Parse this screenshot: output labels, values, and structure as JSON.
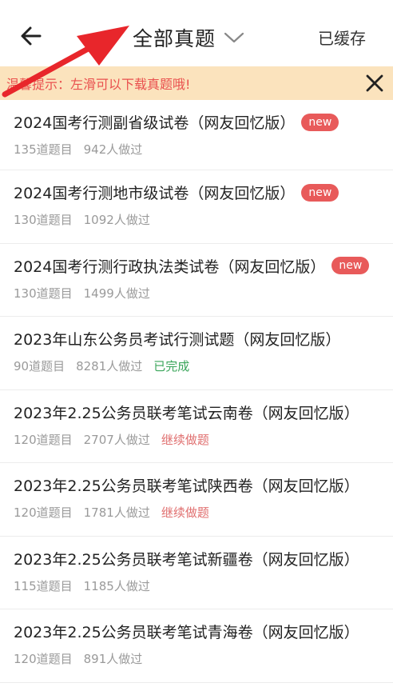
{
  "header": {
    "title": "全部真题",
    "cache_label": "已缓存"
  },
  "tip": {
    "text": "温馨提示：左滑可以下载真题哦!"
  },
  "items": [
    {
      "title": "2024国考行测副省级试卷（网友回忆版）",
      "badge": "new",
      "count": "135道题目",
      "people": "942人做过",
      "status": ""
    },
    {
      "title": "2024国考行测地市级试卷（网友回忆版）",
      "badge": "new",
      "count": "130道题目",
      "people": "1092人做过",
      "status": ""
    },
    {
      "title": "2024国考行测行政执法类试卷（网友回忆版）",
      "badge": "new",
      "count": "130道题目",
      "people": "1499人做过",
      "status": ""
    },
    {
      "title": "2023年山东公务员考试行测试题（网友回忆版）",
      "badge": "",
      "count": "90道题目",
      "people": "8281人做过",
      "status": "已完成"
    },
    {
      "title": "2023年2.25公务员联考笔试云南卷（网友回忆版）",
      "badge": "",
      "count": "120道题目",
      "people": "2707人做过",
      "status": "继续做题"
    },
    {
      "title": "2023年2.25公务员联考笔试陕西卷（网友回忆版）",
      "badge": "",
      "count": "120道题目",
      "people": "1781人做过",
      "status": "继续做题"
    },
    {
      "title": "2023年2.25公务员联考笔试新疆卷（网友回忆版）",
      "badge": "",
      "count": "115道题目",
      "people": "1185人做过",
      "status": ""
    },
    {
      "title": "2023年2.25公务员联考笔试青海卷（网友回忆版）",
      "badge": "",
      "count": "120道题目",
      "people": "891人做过",
      "status": ""
    }
  ],
  "colors": {
    "tip_bg": "#fbe3bd",
    "tip_text": "#e9504e",
    "badge": "#e85a5a",
    "done": "#3aa55a",
    "continue": "#e06f6f",
    "annotation_arrow": "#e8262b"
  },
  "icons": {
    "back": "arrow-left-icon",
    "dropdown": "chevron-down-icon",
    "close": "close-icon"
  }
}
